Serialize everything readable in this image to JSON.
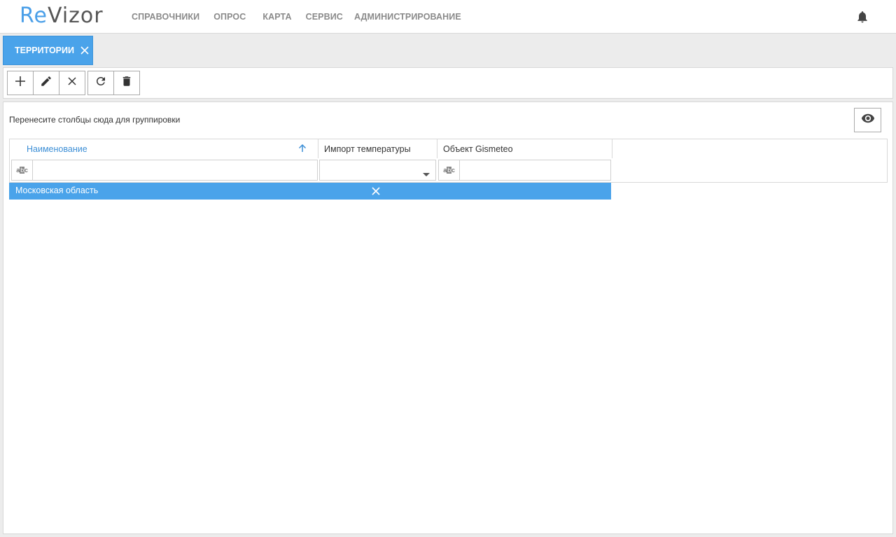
{
  "app": {
    "logo_first": "Re",
    "logo_rest": "Vizor"
  },
  "nav": {
    "items": [
      {
        "label": "СПРАВОЧНИКИ"
      },
      {
        "label": "ОПРОС"
      },
      {
        "label": "КАРТА"
      },
      {
        "label": "СЕРВИС"
      },
      {
        "label": "АДМИНИСТРИРОВАНИЕ"
      }
    ],
    "notification_icon": "bell-icon"
  },
  "tabs": [
    {
      "label": "ТЕРРИТОРИИ",
      "active": true,
      "close_icon": "close-icon"
    }
  ],
  "toolbar": {
    "buttons": [
      {
        "icon": "plus-icon",
        "action": "add"
      },
      {
        "icon": "pencil-icon",
        "action": "edit"
      },
      {
        "icon": "close-icon",
        "action": "cancel"
      },
      {
        "icon": "refresh-icon",
        "action": "refresh"
      },
      {
        "icon": "trash-icon",
        "action": "delete"
      }
    ]
  },
  "grid": {
    "group_hint": "Перенесите столбцы сюда для группировки",
    "column_chooser_icon": "eye-icon",
    "columns": [
      {
        "label": "Наименование",
        "sorted": "asc",
        "sort_icon": "arrow-up-icon"
      },
      {
        "label": "Импорт температуры"
      },
      {
        "label": "Объект Gismeteo"
      }
    ],
    "filters": {
      "name_value": "",
      "temperature_value": "",
      "gismeteo_value": "",
      "abc_label_a": "a",
      "abc_label_b": "b",
      "abc_label_c": "c"
    },
    "rows": [
      {
        "name": "Московская область",
        "selected": true
      }
    ]
  },
  "colors": {
    "accent": "#4aa3ea",
    "header_sorted_text": "#3d8fd6",
    "nav_text": "#8a8a8a"
  }
}
